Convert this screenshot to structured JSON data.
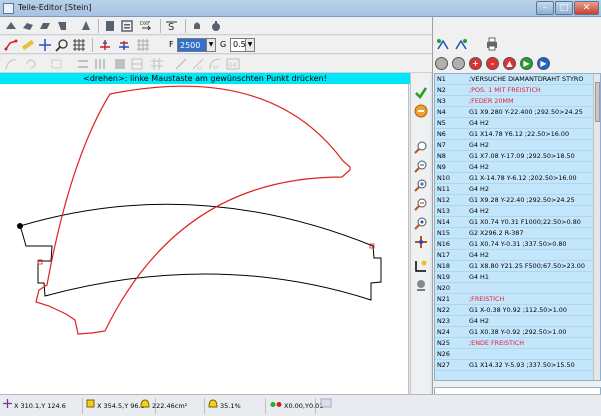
{
  "window": {
    "title": "Teile-Editor [Stein]"
  },
  "toolbar2": {
    "f_label": "F",
    "f_value": "2500",
    "g_label": "G",
    "g_value": "0.5"
  },
  "hint": "<drehen>: linke Maustaste am gewünschten Punkt drücken!",
  "nc_rows": [
    {
      "n": "N1",
      "cmd": ";VERSUCHE DIAMANTDRAHT  STYRO",
      "comment": false
    },
    {
      "n": "N2",
      "cmd": ";POS. 1 MIT FREISTICH",
      "comment": true
    },
    {
      "n": "N3",
      "cmd": ";FEDER 20MM",
      "comment": true
    },
    {
      "n": "N4",
      "cmd": "G1 X9.280 Y-22.400 ;292.50>24.25",
      "comment": false
    },
    {
      "n": "N5",
      "cmd": "G4 H2",
      "comment": false
    },
    {
      "n": "N6",
      "cmd": "G1 X14.78 Y6.12 ;22.50>16.00",
      "comment": false
    },
    {
      "n": "N7",
      "cmd": "G4 H2",
      "comment": false
    },
    {
      "n": "N8",
      "cmd": "G1 X7.08 Y-17.09 ;292.50>18.50",
      "comment": false
    },
    {
      "n": "N9",
      "cmd": "G4 H2",
      "comment": false
    },
    {
      "n": "N10",
      "cmd": "G1 X-14.78 Y-6.12 ;202.50>16.00",
      "comment": false
    },
    {
      "n": "N11",
      "cmd": "G4 H2",
      "comment": false
    },
    {
      "n": "N12",
      "cmd": "G1 X9.28 Y-22.40 ;292.50>24.25",
      "comment": false
    },
    {
      "n": "N13",
      "cmd": "G4 H2",
      "comment": false
    },
    {
      "n": "N14",
      "cmd": "G1 X0.74 Y0.31 F1000;22.50>0.80",
      "comment": false
    },
    {
      "n": "N15",
      "cmd": "G2 X296.2 R-387",
      "comment": false
    },
    {
      "n": "N16",
      "cmd": "G1 X0.74 Y-0.31 ;337.50>0.80",
      "comment": false
    },
    {
      "n": "N17",
      "cmd": "G4 H2",
      "comment": false
    },
    {
      "n": "N18",
      "cmd": "G1 X8.80 Y21.25 F500;67.50>23.00",
      "comment": false
    },
    {
      "n": "N19",
      "cmd": "G4 H1",
      "comment": false
    },
    {
      "n": "N20",
      "cmd": "",
      "comment": false
    },
    {
      "n": "N21",
      "cmd": ";FREISTICH",
      "comment": true
    },
    {
      "n": "N22",
      "cmd": "G1 X-0.38 Y0.92 ;112.50>1.00",
      "comment": false
    },
    {
      "n": "N23",
      "cmd": "G4 H2",
      "comment": false
    },
    {
      "n": "N24",
      "cmd": "G1 X0.38 Y-0.92 ;292.50>1.00",
      "comment": false
    },
    {
      "n": "N25",
      "cmd": ";ENDE FREISTICH",
      "comment": true
    },
    {
      "n": "N26",
      "cmd": "",
      "comment": false
    },
    {
      "n": "N27",
      "cmd": "G1 X14.32 Y-5.93 ;337.50>15.50",
      "comment": false
    }
  ],
  "status": {
    "cursor": "X 310.1,Y 124.6",
    "point": "X 354.5,Y  96.8",
    "area": "222.46cm²",
    "percent": "35.1%",
    "origin": "X0.00,Y0.01"
  },
  "colors": {
    "accent": "#00e8f8",
    "list_bg": "#c4e6fb",
    "red_path": "#e02020",
    "comment_text": "#e0203a"
  }
}
